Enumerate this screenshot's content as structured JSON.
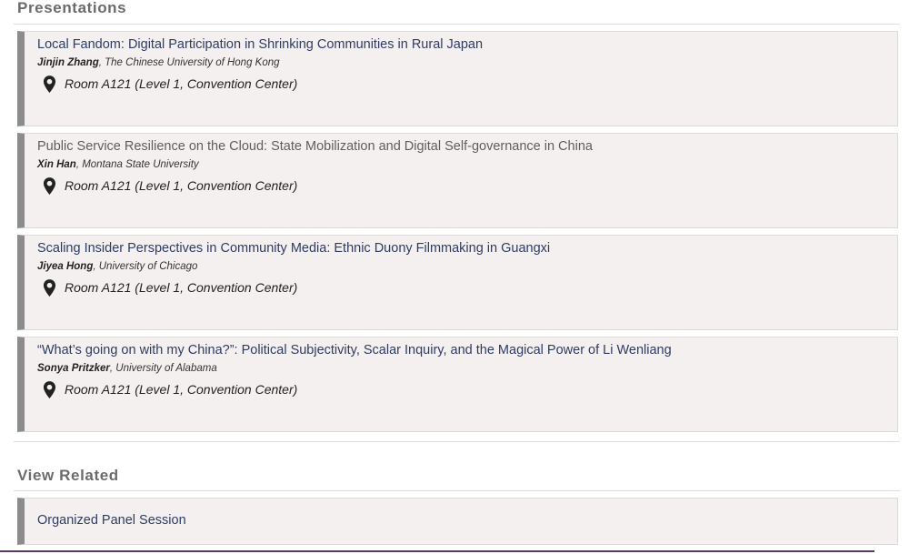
{
  "presentations": {
    "heading": "Presentations",
    "items": [
      {
        "title": "Local Fandom: Digital Participation in Shrinking Communities in Rural Japan",
        "author": "Jinjin Zhang",
        "affiliation": ", The Chinese University of Hong Kong",
        "location": "Room A121 (Level 1, Convention Center)"
      },
      {
        "title": "Public Service Resilience on the Cloud: State Mobilization and Digital Self-governance in China",
        "author": "Xin Han",
        "affiliation": ", Montana State University",
        "location": "Room A121 (Level 1, Convention Center)"
      },
      {
        "title": "Scaling Insider Perspectives in Community Media: Ethnic Duony Filmmaking in Guangxi",
        "author": "Jiyea Hong",
        "affiliation": ", University of Chicago",
        "location": "Room A121 (Level 1, Convention Center)"
      },
      {
        "title": "“What’s going on with my China?”: Political Subjectivity, Scalar Inquiry, and the Magical Power of Li Wenliang",
        "author": "Sonya Pritzker",
        "affiliation": ", University of Alabama",
        "location": "Room A121 (Level 1, Convention Center)"
      }
    ]
  },
  "related": {
    "heading": "View Related",
    "items": [
      {
        "label": "Organized Panel Session"
      }
    ]
  },
  "icons": {
    "location": "map-pin-icon"
  },
  "colors": {
    "link": "#2e3b63",
    "card_bg": "#f5f0f0",
    "card_accent": "#8c8c8c",
    "heading": "#6b6b6b",
    "footer_bar": "#5b3a6b"
  }
}
